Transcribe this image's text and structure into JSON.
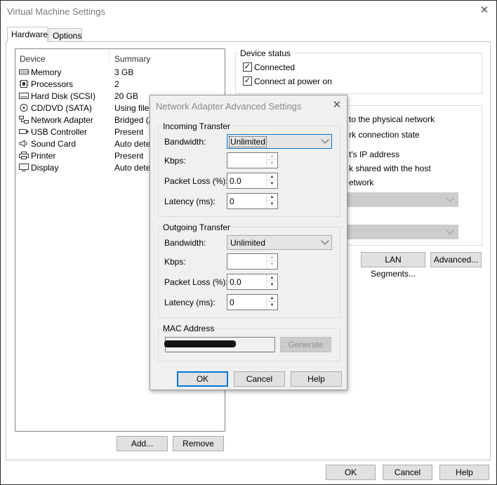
{
  "window": {
    "title": "Virtual Machine Settings",
    "close": "✕"
  },
  "tabs": [
    {
      "label": "Hardware"
    },
    {
      "label": "Options"
    }
  ],
  "device_list": {
    "headers": [
      "Device",
      "Summary"
    ],
    "rows": [
      {
        "device": "Memory",
        "summary": "3 GB",
        "icon": "memory-icon"
      },
      {
        "device": "Processors",
        "summary": "2",
        "icon": "processor-icon"
      },
      {
        "device": "Hard Disk (SCSI)",
        "summary": "20 GB",
        "icon": "hard-disk-icon"
      },
      {
        "device": "CD/DVD (SATA)",
        "summary": "Using file D",
        "icon": "cd-dvd-icon"
      },
      {
        "device": "Network Adapter",
        "summary": "Bridged (Au",
        "icon": "network-adapter-icon"
      },
      {
        "device": "USB Controller",
        "summary": "Present",
        "icon": "usb-icon"
      },
      {
        "device": "Sound Card",
        "summary": "Auto detec",
        "icon": "sound-card-icon"
      },
      {
        "device": "Printer",
        "summary": "Present",
        "icon": "printer-icon"
      },
      {
        "device": "Display",
        "summary": "Auto detec",
        "icon": "display-icon"
      }
    ],
    "add_label": "Add...",
    "remove_label": "Remove"
  },
  "device_status": {
    "title": "Device status",
    "connected": "Connected",
    "connect_at_power_on": "Connect at power on",
    "connected_checked": true,
    "connect_at_power_on_checked": true
  },
  "network_connection": {
    "visible_texts": [
      "to the physical network",
      "rk connection state",
      "t's IP address",
      "k shared with the host",
      "etwork"
    ],
    "lan_segments_label": "LAN Segments...",
    "advanced_label": "Advanced..."
  },
  "footer": {
    "ok": "OK",
    "cancel": "Cancel",
    "help": "Help"
  },
  "dialog": {
    "title": "Network Adapter Advanced Settings",
    "close": "✕",
    "incoming": {
      "title": "Incoming Transfer",
      "bandwidth_label": "Bandwidth:",
      "bandwidth_value": "Unlimited",
      "kbps_label": "Kbps:",
      "kbps_value": "",
      "packet_loss_label": "Packet Loss (%):",
      "packet_loss_value": "0.0",
      "latency_label": "Latency (ms):",
      "latency_value": "0"
    },
    "outgoing": {
      "title": "Outgoing Transfer",
      "bandwidth_label": "Bandwidth:",
      "bandwidth_value": "Unlimited",
      "kbps_label": "Kbps:",
      "kbps_value": "",
      "packet_loss_label": "Packet Loss (%):",
      "packet_loss_value": "0.0",
      "latency_label": "Latency (ms):",
      "latency_value": "0"
    },
    "mac": {
      "title": "MAC Address",
      "generate_label": "Generate"
    },
    "ok": "OK",
    "cancel": "Cancel",
    "help": "Help"
  },
  "colors": {
    "focus": "#0078d7",
    "dialog_bg": "#f0f0f0",
    "disabled": "#cccccc"
  }
}
